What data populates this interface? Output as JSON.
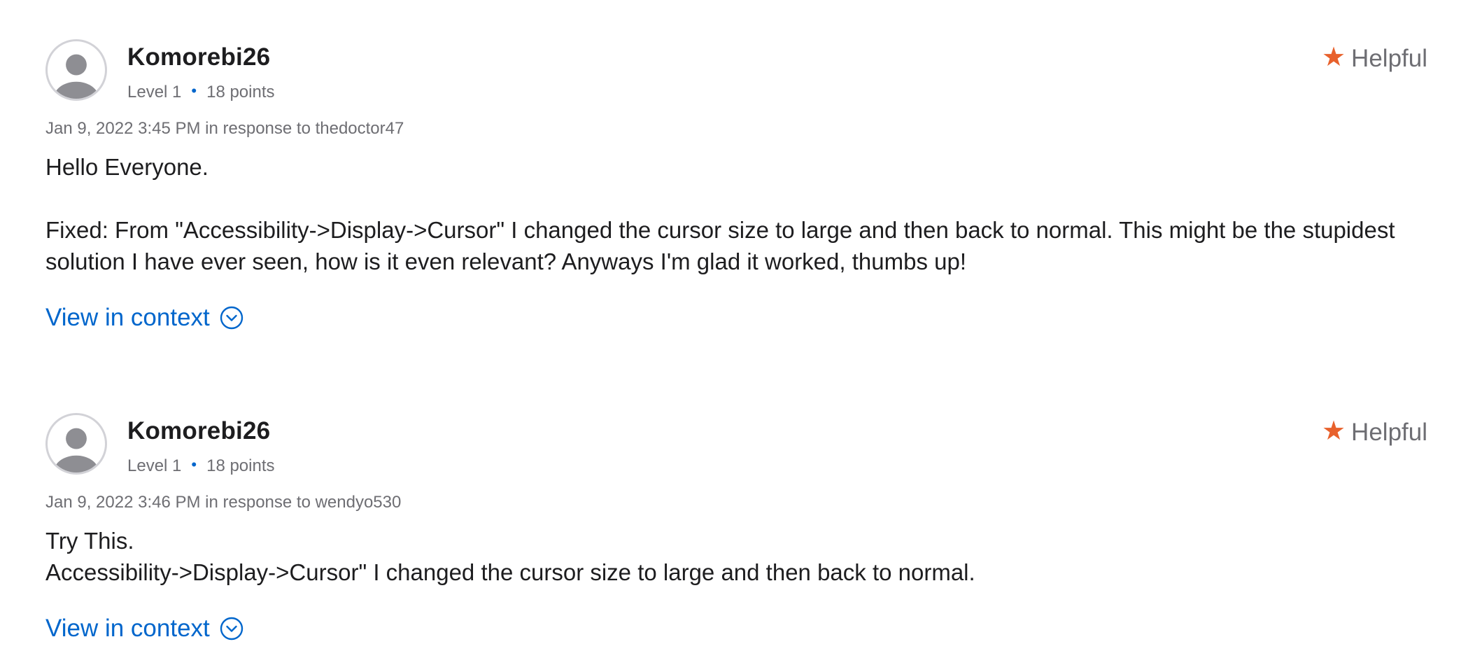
{
  "posts": [
    {
      "author": "Komorebi26",
      "level": "Level 1",
      "points": "18 points",
      "helpful_label": "Helpful",
      "date_line": "Jan 9, 2022 3:45 PM in response to thedoctor47",
      "body": [
        "Hello Everyone.",
        "",
        "Fixed: From \"Accessibility->Display->Cursor\" I changed the cursor size to large and then back to normal. This might be the stupidest solution I have ever seen, how is it even relevant? Anyways I'm glad it worked, thumbs up!"
      ],
      "view_context_label": "View in context"
    },
    {
      "author": "Komorebi26",
      "level": "Level 1",
      "points": "18 points",
      "helpful_label": "Helpful",
      "date_line": "Jan 9, 2022 3:46 PM in response to wendyo530",
      "body": [
        "Try This.",
        "Accessibility->Display->Cursor\" I changed the cursor size to large and then back to normal."
      ],
      "view_context_label": "View in context"
    }
  ],
  "icons": {
    "avatar": "user-avatar-icon",
    "helpful": "star-icon",
    "view_context": "chevron-down-circle-icon"
  },
  "colors": {
    "link": "#0066cc",
    "star": "#e8612c",
    "meta": "#6e6e73",
    "text": "#1d1d1f",
    "dot": "#0066cc"
  }
}
